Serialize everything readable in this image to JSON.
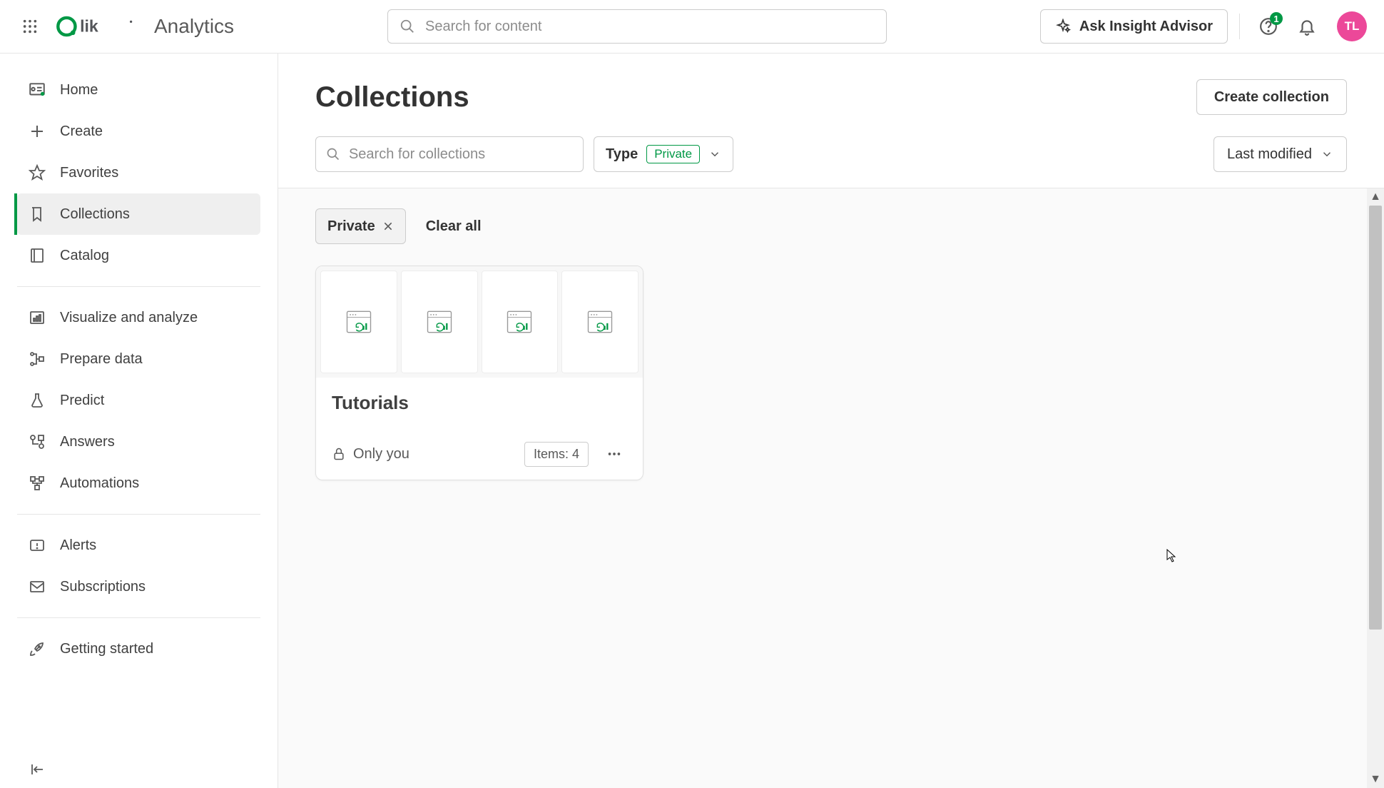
{
  "header": {
    "app_title": "Analytics",
    "search_placeholder": "Search for content",
    "ask_label": "Ask Insight Advisor",
    "notification_count": "1",
    "avatar_initials": "TL"
  },
  "sidebar": {
    "items": [
      {
        "label": "Home"
      },
      {
        "label": "Create"
      },
      {
        "label": "Favorites"
      },
      {
        "label": "Collections"
      },
      {
        "label": "Catalog"
      },
      {
        "label": "Visualize and analyze"
      },
      {
        "label": "Prepare data"
      },
      {
        "label": "Predict"
      },
      {
        "label": "Answers"
      },
      {
        "label": "Automations"
      },
      {
        "label": "Alerts"
      },
      {
        "label": "Subscriptions"
      },
      {
        "label": "Getting started"
      }
    ]
  },
  "page": {
    "title": "Collections",
    "create_label": "Create collection",
    "search_placeholder": "Search for collections",
    "type_filter": {
      "label": "Type",
      "value": "Private"
    },
    "sort_label": "Last modified",
    "active_chip": "Private",
    "clear_all": "Clear all",
    "card": {
      "title": "Tutorials",
      "privacy": "Only you",
      "items_label": "Items: 4"
    }
  },
  "colors": {
    "accent_green": "#009845",
    "avatar_pink": "#ec4899"
  }
}
